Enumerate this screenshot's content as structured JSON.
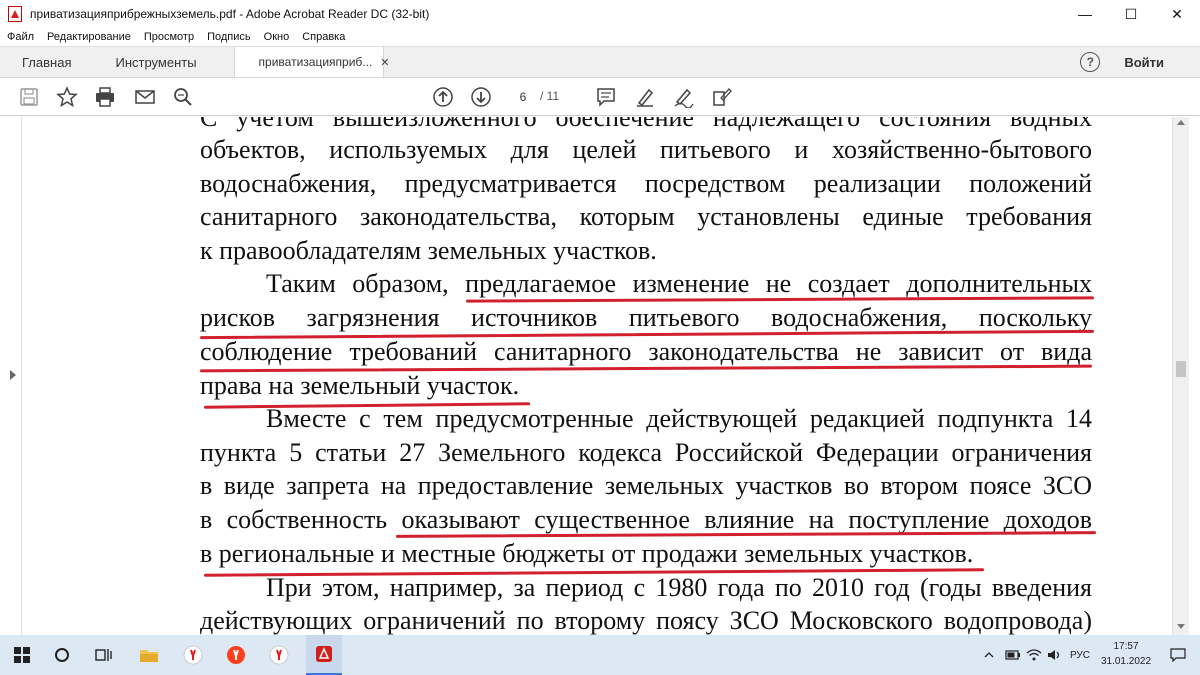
{
  "window": {
    "title": "приватизацияприбрежныхземель.pdf - Adobe Acrobat Reader DC (32-bit)",
    "minimize": "—",
    "maximize": "☐",
    "close": "✕"
  },
  "menu": {
    "items": [
      "Файл",
      "Редактирование",
      "Просмотр",
      "Подпись",
      "Окно",
      "Справка"
    ]
  },
  "tabs": {
    "home": "Главная",
    "tools": "Инструменты",
    "document": "приватизацияприб...",
    "close": "✕",
    "help": "?",
    "signin": "Войти"
  },
  "toolbar": {
    "page_current": "6",
    "page_total": "/ 11"
  },
  "document": {
    "lines": [
      "С учетом вышеизложенного обеспечение надлежащего состояния водных",
      "объектов, используемых для целей питьевого и хозяйственно-бытового",
      "водоснабжения, предусматривается посредством реализации положений",
      "санитарного законодательства, которым установлены единые требования",
      "к правообладателям земельных участков.",
      "Таким образом, предлагаемое изменение не создает дополнительных",
      "рисков загрязнения источников питьевого водоснабжения, поскольку",
      "соблюдение требований санитарного законодательства не зависит от вида",
      "права на земельный участок.",
      "Вместе с тем предусмотренные действующей редакцией подпункта 14",
      "пункта 5 статьи 27 Земельного кодекса Российской Федерации ограничения",
      "в виде запрета на предоставление земельных участков во втором поясе ЗСО",
      "в собственность оказывают существенное влияние на поступление доходов",
      "в региональные и местные бюджеты от продажи земельных участков.",
      "При этом, например, за период с 1980 года по 2010 год (годы введения",
      "действующих ограничений по второму поясу ЗСО Московского водопровода)"
    ]
  },
  "taskbar": {
    "language": "РУС",
    "time": "17:57",
    "date": "31.01.2022"
  },
  "colors": {
    "underline": "#d2202f",
    "taskbar": "#dde8f5",
    "acrobat_red": "#d4201c"
  }
}
